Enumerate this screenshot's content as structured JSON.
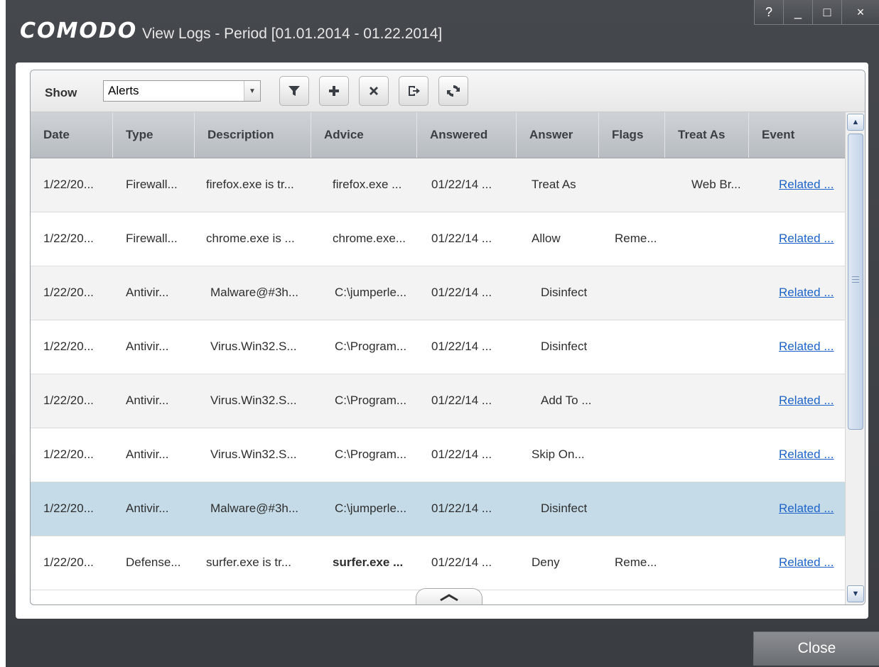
{
  "window": {
    "brand": "COMODO",
    "title": "View Logs - Period [01.01.2014 - 01.22.2014]",
    "controls": [
      "?",
      "_",
      "□",
      "×"
    ]
  },
  "toolbar": {
    "show_label": "Show",
    "filter_value": "Alerts",
    "icons": [
      "filter-icon",
      "add-icon",
      "delete-icon",
      "export-icon",
      "refresh-icon"
    ]
  },
  "table": {
    "columns": [
      "Date",
      "Type",
      "Description",
      "Advice",
      "Answered",
      "Answer",
      "Flags",
      "Treat As",
      "Event"
    ],
    "rows": [
      [
        "1/22/20...",
        "Firewall...",
        "firefox.exe is tr...",
        "firefox.exe ...",
        "01/22/14 ...",
        "Treat As",
        "",
        "Web Br...",
        "Related ..."
      ],
      [
        "1/22/20...",
        "Firewall...",
        "chrome.exe is ...",
        "chrome.exe...",
        "01/22/14 ...",
        "Allow",
        "Reme...",
        "",
        "Related ..."
      ],
      [
        "1/22/20...",
        "Antivir...",
        "Malware@#3h...",
        "C:\\jumperle...",
        "01/22/14 ...",
        "Disinfect",
        "",
        "",
        "Related ..."
      ],
      [
        "1/22/20...",
        "Antivir...",
        "Virus.Win32.S...",
        "C:\\Program...",
        "01/22/14 ...",
        "Disinfect",
        "",
        "",
        "Related ..."
      ],
      [
        "1/22/20...",
        "Antivir...",
        "Virus.Win32.S...",
        "C:\\Program...",
        "01/22/14 ...",
        "Add To ...",
        "",
        "",
        "Related ..."
      ],
      [
        "1/22/20...",
        "Antivir...",
        "Virus.Win32.S...",
        "C:\\Program...",
        "01/22/14 ...",
        "Skip On...",
        "",
        "",
        "Related ..."
      ],
      [
        "1/22/20...",
        "Antivir...",
        "Malware@#3h...",
        "C:\\jumperle...",
        "01/22/14 ...",
        "Disinfect",
        "",
        "",
        "Related ..."
      ],
      [
        "1/22/20...",
        "Defense...",
        "surfer.exe is tr...",
        "surfer.exe ...",
        "01/22/14 ...",
        "Deny",
        "Reme...",
        "",
        "Related ..."
      ]
    ],
    "selected_row": 6
  },
  "footer": {
    "close_label": "Close"
  }
}
